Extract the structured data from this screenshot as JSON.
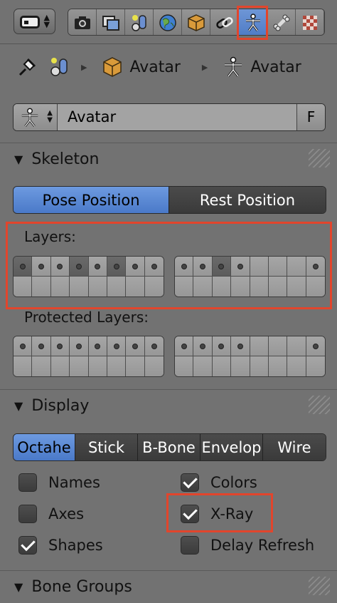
{
  "header": {
    "tabs": [
      {
        "name": "render",
        "icon": "camera-icon"
      },
      {
        "name": "render-layers",
        "icon": "render-layers-icon"
      },
      {
        "name": "scene",
        "icon": "scene-icon"
      },
      {
        "name": "world",
        "icon": "world-icon"
      },
      {
        "name": "object",
        "icon": "object-cube-icon"
      },
      {
        "name": "constraints",
        "icon": "chain-link-icon"
      },
      {
        "name": "armature-data",
        "icon": "armature-figure-icon",
        "active": true
      },
      {
        "name": "bone",
        "icon": "bone-icon"
      },
      {
        "name": "texture",
        "icon": "checker-texture-icon"
      }
    ]
  },
  "breadcrumb": {
    "object_name": "Avatar",
    "data_name": "Avatar"
  },
  "datablock": {
    "name": "Avatar",
    "fake_user": "F"
  },
  "skeleton": {
    "title": "Skeleton",
    "pose_position": "Pose Position",
    "rest_position": "Rest Position",
    "layers_label": "Layers:",
    "protected_layers_label": "Protected Layers:",
    "layers_left_top": [
      1,
      1,
      1,
      1,
      1,
      1,
      1,
      1
    ],
    "layers_left_top_on": [
      1,
      0,
      0,
      1,
      0,
      1,
      0,
      0
    ],
    "layers_right_top": [
      1,
      1,
      1,
      1,
      0,
      0,
      0,
      1
    ],
    "layers_right_top_on": [
      0,
      0,
      1,
      0,
      0,
      0,
      0,
      0
    ],
    "protected_left_top": [
      1,
      1,
      1,
      1,
      1,
      1,
      1,
      1
    ],
    "protected_right_top": [
      1,
      1,
      1,
      1,
      0,
      0,
      0,
      1
    ]
  },
  "display": {
    "title": "Display",
    "modes": [
      "Octahe",
      "Stick",
      "B-Bone",
      "Envelop",
      "Wire"
    ],
    "selected_mode": "Octahe",
    "options": {
      "names": {
        "label": "Names",
        "checked": false
      },
      "axes": {
        "label": "Axes",
        "checked": false
      },
      "shapes": {
        "label": "Shapes",
        "checked": true
      },
      "colors": {
        "label": "Colors",
        "checked": true
      },
      "xray": {
        "label": "X-Ray",
        "checked": true
      },
      "delay_refresh": {
        "label": "Delay Refresh",
        "checked": false
      }
    }
  },
  "bone_groups": {
    "title": "Bone Groups"
  },
  "colors": {
    "highlight": "#e2452c",
    "selected": "#5a88d4"
  }
}
